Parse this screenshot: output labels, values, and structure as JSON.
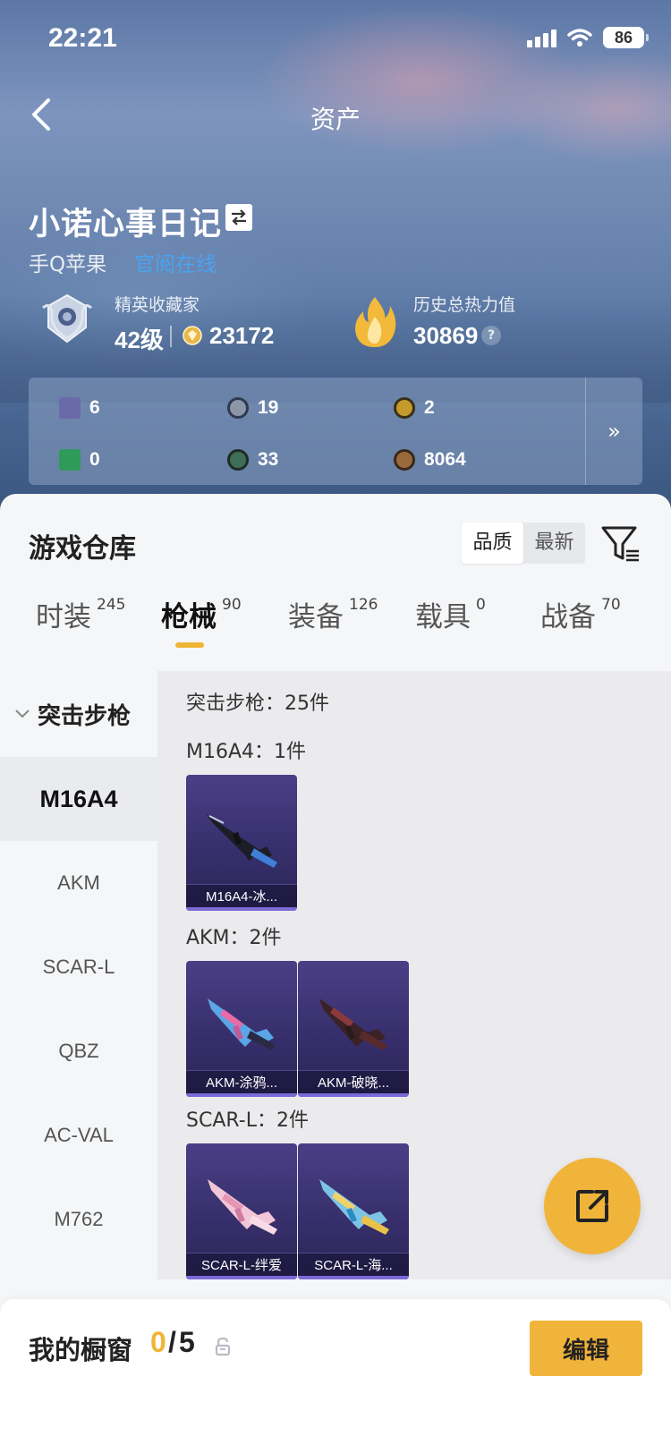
{
  "status_bar": {
    "time": "22:21",
    "battery": "86"
  },
  "nav": {
    "title": "资产"
  },
  "profile": {
    "name": "小诺心事日记",
    "platform": "手Q苹果",
    "platform_link": "官阅在线",
    "rank_title": "精英收藏家",
    "rank_level": "42级",
    "coins": "23172",
    "heat_title": "历史总热力值",
    "heat_value": "30869",
    "help": "?"
  },
  "currencies": [
    {
      "value": "6",
      "icon": "purple-card-icon",
      "color": "#6a6aa8"
    },
    {
      "value": "19",
      "icon": "silver-ring-coin-icon",
      "color": "#8c96a6"
    },
    {
      "value": "2",
      "icon": "gold-token-icon",
      "color": "#c69a2a"
    },
    {
      "value": "0",
      "icon": "green-card-icon",
      "color": "#2f9a5a"
    },
    {
      "value": "33",
      "icon": "green-orb-coin-icon",
      "color": "#3e6e56"
    },
    {
      "value": "8064",
      "icon": "bronze-coin-icon",
      "color": "#9a6a3c"
    }
  ],
  "more_arrows": "»",
  "warehouse": {
    "title": "游戏仓库",
    "sort_options": [
      "品质",
      "最新"
    ],
    "sort_selected": "品质"
  },
  "tabs": [
    {
      "label": "时装",
      "count": "245"
    },
    {
      "label": "枪械",
      "count": "90"
    },
    {
      "label": "装备",
      "count": "126"
    },
    {
      "label": "载具",
      "count": "0"
    },
    {
      "label": "战备",
      "count": "70"
    }
  ],
  "active_tab": "枪械",
  "sidebar": {
    "group": "突击步枪",
    "items": [
      "M16A4",
      "AKM",
      "SCAR-L",
      "QBZ",
      "AC-VAL",
      "M762"
    ],
    "selected": "M16A4"
  },
  "content": {
    "summary": "突击步枪：25件",
    "groups": [
      {
        "label": "M16A4：1件",
        "items": [
          "M16A4-冰..."
        ]
      },
      {
        "label": "AKM：2件",
        "items": [
          "AKM-涂鸦...",
          "AKM-破晓..."
        ]
      },
      {
        "label": "SCAR-L：2件",
        "items": [
          "SCAR-L-绊爱",
          "SCAR-L-海..."
        ]
      }
    ]
  },
  "showcase": {
    "title": "我的橱窗",
    "used": "0",
    "slash": "/",
    "total": "5",
    "edit_label": "编辑"
  },
  "colors": {
    "accent": "#f1b43a",
    "card_purple": "#3a3270",
    "link_blue": "#4aa3f0"
  }
}
